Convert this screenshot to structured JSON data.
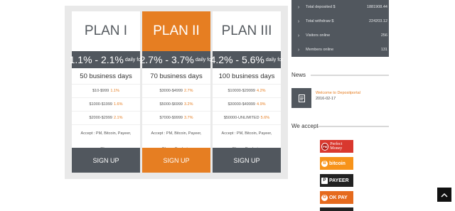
{
  "plans": [
    {
      "name": "PLAN I",
      "rate": "1.1% - 2.1%",
      "rate_suffix": "daily for",
      "days": "50 business days",
      "rows": [
        {
          "range": "$10-$999",
          "pct": "1.1%"
        },
        {
          "range": "$1000-$1999",
          "pct": "1.6%"
        },
        {
          "range": "$2000-$2999",
          "pct": "2.1%"
        }
      ],
      "accept_1": "Accept : PM, Bitcoin, Payeer,",
      "accept_2": "Okpay",
      "signup": "SIGN UP"
    },
    {
      "name": "PLAN II",
      "rate": "2.7% - 3.7%",
      "rate_suffix": "daily for",
      "days": "70 business days",
      "rows": [
        {
          "range": "$3000-$4999",
          "pct": "2.7%"
        },
        {
          "range": "$5000-$6999",
          "pct": "3.2%"
        },
        {
          "range": "$7000-$9999",
          "pct": "3.7%"
        }
      ],
      "accept_1": "Accept : PM, Bitcoin, Payeer,",
      "accept_2": "Okpay, Bankwire",
      "signup": "SIGN UP"
    },
    {
      "name": "PLAN III",
      "rate": "4.2% - 5.6%",
      "rate_suffix": "daily for",
      "days": "100 business days",
      "rows": [
        {
          "range": "$10000-$29999",
          "pct": "4.2%"
        },
        {
          "range": "$30000-$49999",
          "pct": "4.9%"
        },
        {
          "range": "$50000-UNLIMITED",
          "pct": "5.6%"
        }
      ],
      "accept_1": "Accept : PM, Bitcoin, Payeer,",
      "accept_2": "Okpay, Bankwire",
      "signup": "SIGN UP"
    }
  ],
  "stats": [
    {
      "label": "Total deposited $",
      "value": "1881908.44"
    },
    {
      "label": "Total withdraw $",
      "value": "224203.12"
    },
    {
      "label": "Visitors online",
      "value": "256"
    },
    {
      "label": "Members online",
      "value": "131"
    }
  ],
  "news": {
    "title": "News",
    "item_link": "Welcome to Depositportal",
    "item_date": "2016-02-17"
  },
  "accept": {
    "title": "We accept",
    "methods": [
      {
        "name": "Perfect Money",
        "icon": "PM",
        "bg": "#d9382e",
        "icon_bg": "#b11d17"
      },
      {
        "name": "bitcoin",
        "icon": "B",
        "bg": "#f7931a",
        "icon_bg": "#d77800"
      },
      {
        "name": "PAYEER",
        "icon": "P",
        "bg": "#222222",
        "icon_bg": "#222222"
      },
      {
        "name": "OK PAY",
        "icon": "O",
        "bg": "#e56a1d",
        "icon_bg": "#c45210"
      }
    ]
  },
  "colors": {
    "accent": "#e67e22",
    "dark": "#51575e"
  },
  "back_to_top_icon": "chevron-up-icon"
}
